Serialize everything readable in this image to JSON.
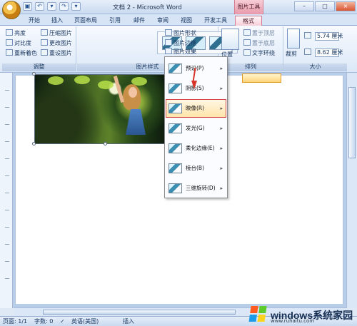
{
  "window": {
    "title": "文档 2 - Microsoft Word",
    "contextual_tab": "图片工具",
    "controls": [
      "–",
      "□",
      "×"
    ]
  },
  "quick_access": [
    {
      "name": "save-icon",
      "symbol": "▣"
    },
    {
      "name": "undo-icon",
      "symbol": "↶"
    },
    {
      "name": "dropdown-icon",
      "symbol": "▾"
    },
    {
      "name": "redo-icon",
      "symbol": "↷"
    },
    {
      "name": "customize-icon",
      "symbol": "▾"
    }
  ],
  "tabs": [
    "开始",
    "插入",
    "页面布局",
    "引用",
    "邮件",
    "审阅",
    "视图",
    "开发工具",
    "格式"
  ],
  "ribbon": {
    "adjust_group_label": "调整",
    "brightness": "亮度",
    "contrast": "对比度",
    "recolor": "重新着色",
    "compress": "压缩图片",
    "change_picture": "更改图片",
    "reset_picture": "重设图片",
    "styles_group_label": "图片样式",
    "picture_shape": "图片形状",
    "picture_border": "图片边框",
    "picture_effects": "图片效果",
    "position": "位置",
    "arrange_group_label": "排列",
    "bring_front": "置于顶层",
    "send_back": "置于底层",
    "text_wrap": "文字环绕",
    "size_group_label": "大小",
    "crop": "裁剪",
    "height_value": "5.74 厘米",
    "width_value": "8.62 厘米"
  },
  "effects_menu": [
    {
      "label": "预设(P)",
      "name": "preset"
    },
    {
      "label": "阴影(S)",
      "name": "shadow"
    },
    {
      "label": "映像(R)",
      "name": "reflection"
    },
    {
      "label": "发光(G)",
      "name": "glow"
    },
    {
      "label": "柔化边缘(E)",
      "name": "soft-edges"
    },
    {
      "label": "棱台(B)",
      "name": "bevel"
    },
    {
      "label": "三维旋转(D)",
      "name": "3d-rotation"
    }
  ],
  "status": {
    "page": "页面: 1/1",
    "words": "字数: 0",
    "language": "英语(美国)",
    "insert": "插入"
  },
  "watermark": {
    "brand": "windows系统家园",
    "site": "www.ruhaitu.com"
  },
  "colors": {
    "contextual_tab": "#f2b7c3",
    "highlight_outline": "#d64545",
    "arrow": "#d8352b",
    "ribbon": "#dce8f7"
  }
}
